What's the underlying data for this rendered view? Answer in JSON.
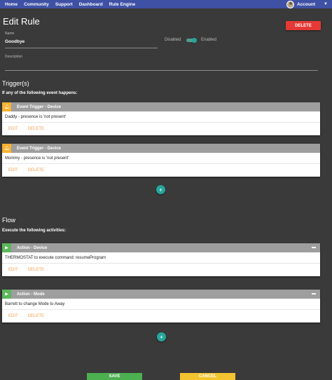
{
  "nav": {
    "items": [
      "Home",
      "Community",
      "Support",
      "Dashboard",
      "Rule Engine"
    ],
    "account_label": "Account"
  },
  "page": {
    "title": "Edit Rule",
    "delete_label": "DELETE"
  },
  "form": {
    "name_label": "Name",
    "name_value": "Goodbye",
    "description_label": "Description",
    "description_value": "",
    "toggle_off_label": "Disabled",
    "toggle_on_label": "Enabled",
    "toggle_enabled": true
  },
  "triggers": {
    "section_title": "Trigger(s)",
    "subtitle": "If any of the following event happens:",
    "cards": [
      {
        "header": "Event Trigger - Device",
        "body": "Daddy - presence is 'not present'",
        "edit": "EDIT",
        "delete": "DELETE"
      },
      {
        "header": "Event Trigger - Device",
        "body": "Mommy - presence is 'not present'",
        "edit": "EDIT",
        "delete": "DELETE"
      }
    ]
  },
  "flow": {
    "section_title": "Flow",
    "subtitle": "Execute the following activities:",
    "cards": [
      {
        "header": "Action - Device",
        "body": "THERMOSTAT to execute command: resumeProgram",
        "edit": "EDIT",
        "delete": "DELETE"
      },
      {
        "header": "Action - Mode",
        "body": "Barrett to change Mode to Away",
        "edit": "EDIT",
        "delete": "DELETE"
      }
    ]
  },
  "footer": {
    "save_label": "SAVE",
    "cancel_label": "CANCEL"
  },
  "colors": {
    "navbar": "#3e51a5",
    "background": "#3a3a3a",
    "delete": "#e53935",
    "accent_teal": "#26a69a",
    "trigger_badge": "#f9b233",
    "action_badge": "#5cb85c",
    "link_orange": "#f0a050"
  },
  "icons": {
    "trigger": "bell-icon",
    "action": "play-icon",
    "add": "plus-icon",
    "minimize": "minimize-icon",
    "dropdown": "caret-down-icon"
  }
}
